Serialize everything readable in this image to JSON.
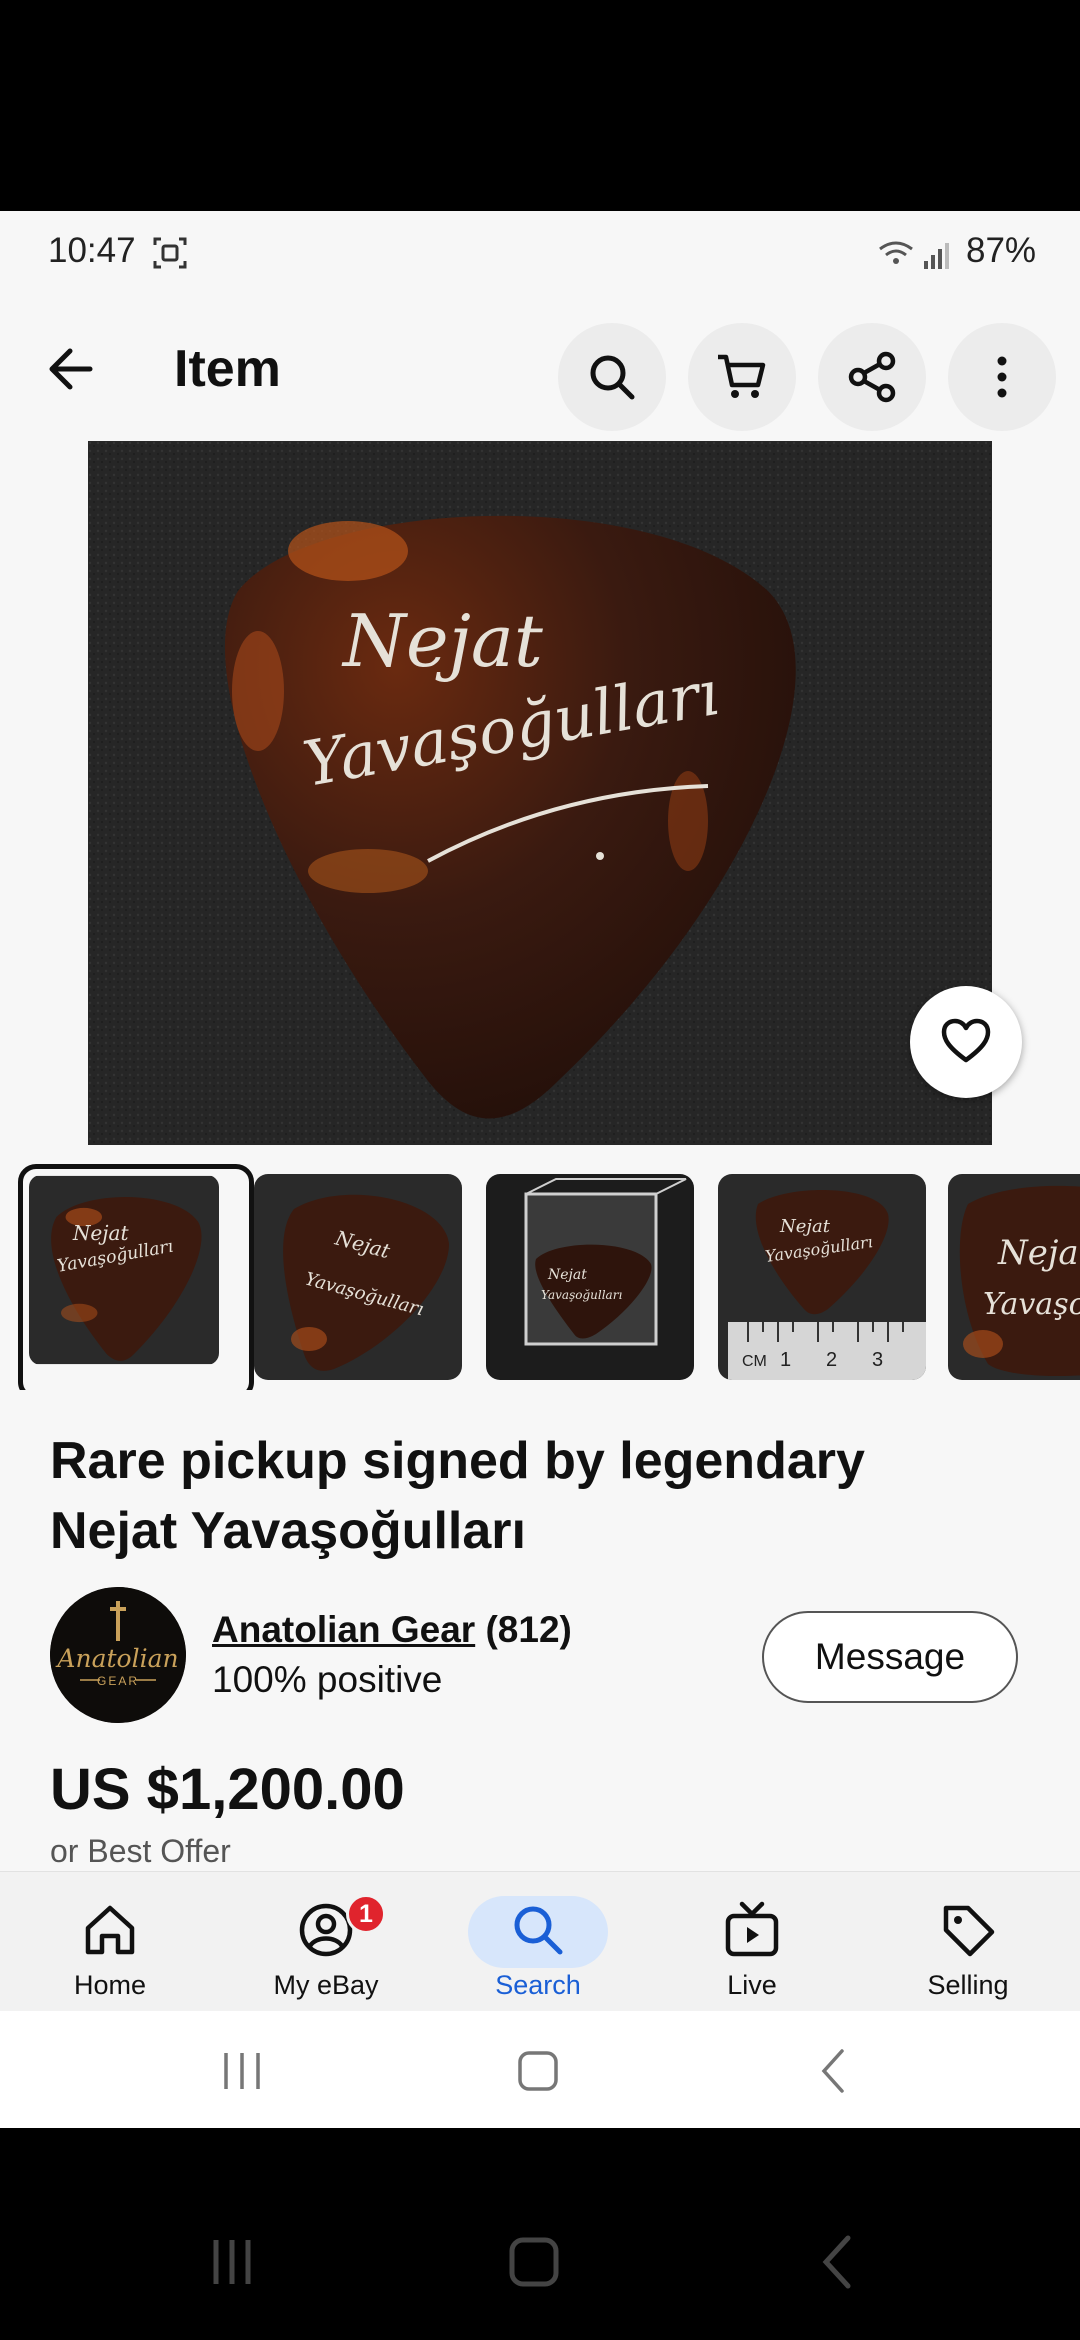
{
  "status_bar": {
    "time": "10:47",
    "battery": "87%"
  },
  "app_bar": {
    "title": "Item",
    "actions": [
      {
        "icon": "search-icon"
      },
      {
        "icon": "cart-icon"
      },
      {
        "icon": "share-icon"
      },
      {
        "icon": "more-vertical-icon"
      }
    ]
  },
  "product_image": {
    "engraving_line1": "Nejat",
    "engraving_line2": "Yavaşoğulları"
  },
  "thumbnails": [
    {
      "selected": true
    },
    {
      "selected": false
    },
    {
      "selected": false
    },
    {
      "selected": false,
      "ruler_unit": "CM",
      "ruler_marks": [
        "1",
        "2",
        "3"
      ]
    },
    {
      "selected": false
    }
  ],
  "listing": {
    "title_line1": "Rare pickup signed by legendary",
    "title_line2": "Nejat Yavaşoğulları",
    "price": "US $1,200.00",
    "offer_note": "or Best Offer"
  },
  "seller": {
    "name": "Anatolian Gear",
    "feedback_count": "(812)",
    "positive": "100% positive",
    "logo_line1": "Anatolian",
    "logo_line2": "GEAR",
    "message_label": "Message"
  },
  "bottom_nav": {
    "items": [
      {
        "label": "Home",
        "icon": "home-icon"
      },
      {
        "label": "My eBay",
        "icon": "profile-icon",
        "badge": "1"
      },
      {
        "label": "Search",
        "icon": "search-icon",
        "active": true
      },
      {
        "label": "Live",
        "icon": "live-tv-icon"
      },
      {
        "label": "Selling",
        "icon": "tag-icon"
      }
    ]
  },
  "colors": {
    "active_blue": "#1a5fd6",
    "badge_red": "#e0242d"
  }
}
